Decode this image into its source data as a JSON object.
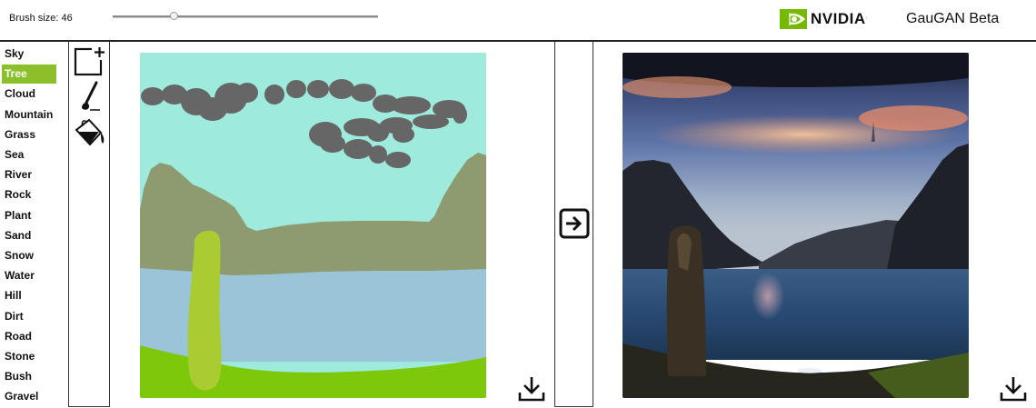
{
  "toolbar": {
    "brush_label": "Brush size: 46",
    "brush_fraction": 0.23
  },
  "brand": {
    "logo_text": "NVIDIA",
    "logo_trademark": ".",
    "app_title": "GauGAN Beta",
    "accent": "#76b900"
  },
  "labels": {
    "selected": "Tree",
    "items": [
      "Sky",
      "Tree",
      "Cloud",
      "Mountain",
      "Grass",
      "Sea",
      "River",
      "Rock",
      "Plant",
      "Sand",
      "Snow",
      "Water",
      "Hill",
      "Dirt",
      "Road",
      "Stone",
      "Bush",
      "Gravel"
    ]
  },
  "tools": [
    "new-canvas-icon",
    "brush-icon",
    "paint-bucket-icon"
  ],
  "palette": {
    "sky": "#9eeadc",
    "cloud": "#666666",
    "mountain": "#8e9a70",
    "sea": "#9ac4d8",
    "grass": "#7dc80a",
    "tree": "#a8cc32"
  },
  "actions": {
    "render_icon": "arrow-right-icon",
    "download_icon": "download-icon"
  }
}
